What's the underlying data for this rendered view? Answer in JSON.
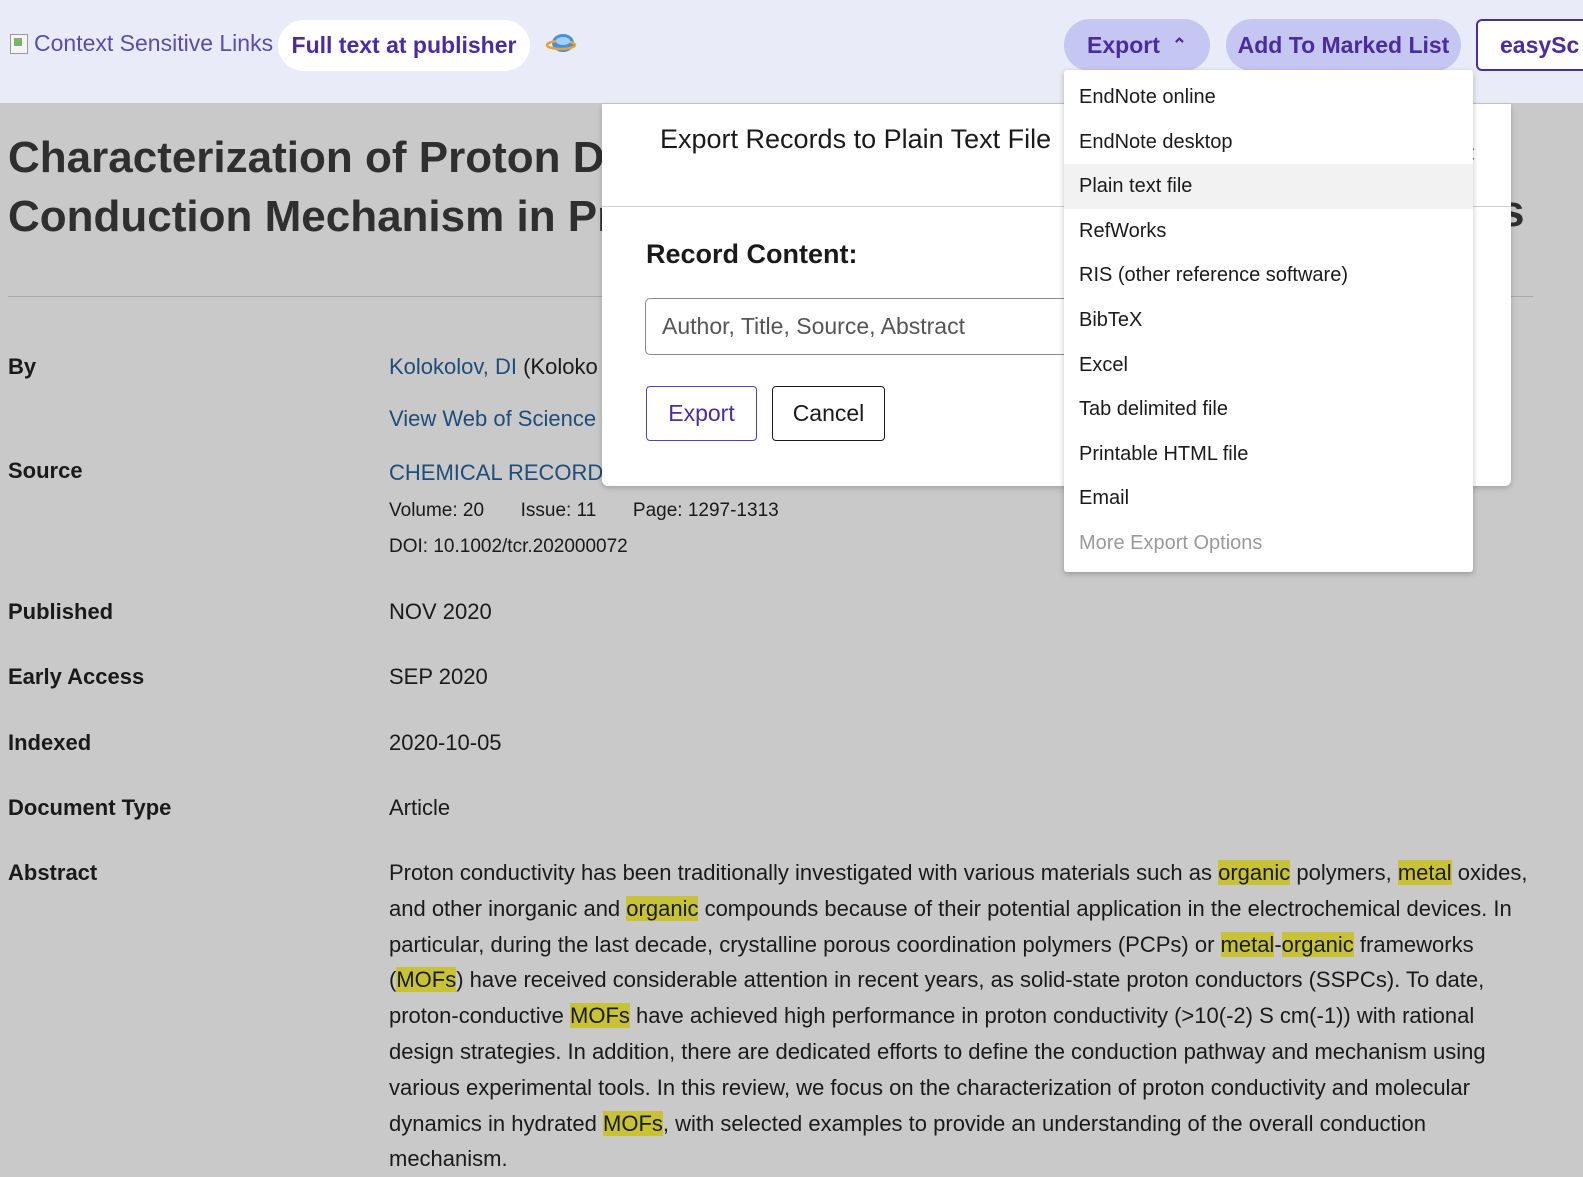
{
  "toolbar": {
    "context_links": "Context Sensitive Links",
    "full_text": "Full text at publisher",
    "export_label": "Export",
    "add_marked": "Add To Marked List",
    "easy": "easySc"
  },
  "export_menu": {
    "items": [
      "EndNote online",
      "EndNote desktop",
      "Plain text file",
      "RefWorks",
      "RIS (other reference software)",
      "BibTeX",
      "Excel",
      "Tab delimited file",
      "Printable HTML file",
      "Email",
      "More Export Options"
    ],
    "active_index": 2
  },
  "modal": {
    "title": "Export Records to Plain Text File",
    "record_label": "Record Content:",
    "record_value": "Author, Title, Source, Abstract",
    "export_btn": "Export",
    "cancel_btn": "Cancel"
  },
  "article": {
    "title_line1": "Characterization of Proton D",
    "title_line2": "Conduction Mechanism in Pr",
    "title_trailing": "s",
    "labels": {
      "by": "By",
      "source": "Source",
      "published": "Published",
      "early_access": "Early Access",
      "indexed": "Indexed",
      "doc_type": "Document Type",
      "abstract": "Abstract"
    },
    "author_link": "Kolokolov, DI",
    "author_paren": "(Koloko",
    "view_wos": "View Web of Science R",
    "source_name": "CHEMICAL RECORD",
    "volume": "Volume: 20",
    "issue": "Issue: 11",
    "page": "Page: 1297-1313",
    "doi": "DOI: 10.1002/tcr.202000072",
    "published": "NOV 2020",
    "early_access": "SEP 2020",
    "indexed": "2020-10-05",
    "doc_type": "Article",
    "abstract_segments": [
      {
        "t": "Proton conductivity has been traditionally investigated with various materials such as ",
        "h": false
      },
      {
        "t": "organic",
        "h": true
      },
      {
        "t": " polymers, ",
        "h": false
      },
      {
        "t": "metal",
        "h": true
      },
      {
        "t": " oxides, and other inorganic and ",
        "h": false
      },
      {
        "t": "organic",
        "h": true
      },
      {
        "t": " compounds because of their potential application in the electrochemical devices. In particular, during the last decade, crystalline porous coordination polymers (PCPs) or ",
        "h": false
      },
      {
        "t": "metal",
        "h": true
      },
      {
        "t": "-",
        "h": false
      },
      {
        "t": "organic",
        "h": true
      },
      {
        "t": " frameworks (",
        "h": false
      },
      {
        "t": "MOFs",
        "h": true
      },
      {
        "t": ") have received considerable attention in recent years, as solid-state proton conductors (SSPCs). To date, proton-conductive ",
        "h": false
      },
      {
        "t": "MOFs",
        "h": true
      },
      {
        "t": " have achieved high performance in proton conductivity (>10(-2) S cm(-1)) with rational design strategies. In addition, there are dedicated efforts to define the conduction pathway and mechanism using various experimental tools. In this review, we focus on the characterization of proton conductivity and molecular dynamics in hydrated ",
        "h": false
      },
      {
        "t": "MOFs",
        "h": true
      },
      {
        "t": ", with selected examples to provide an understanding of the overall conduction mechanism.",
        "h": false
      }
    ]
  }
}
